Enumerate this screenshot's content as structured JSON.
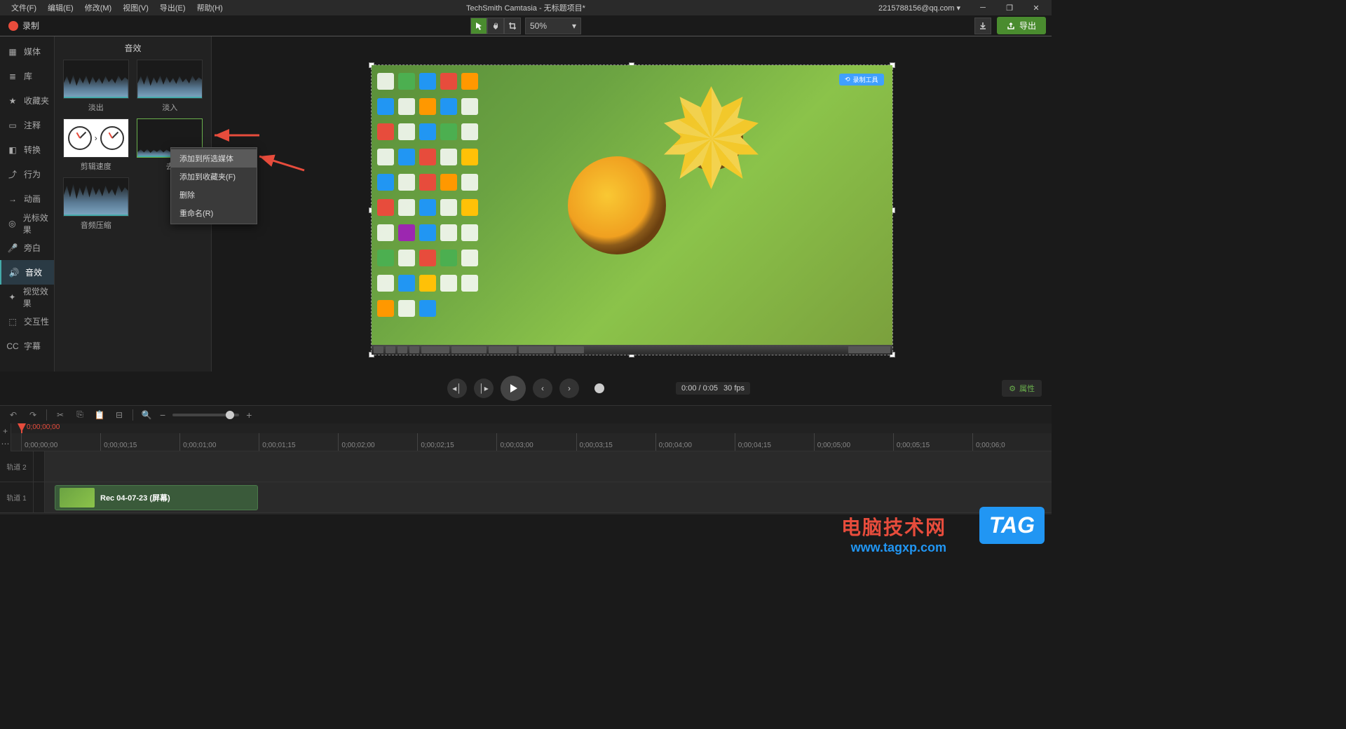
{
  "menubar": {
    "items": [
      "文件(F)",
      "编辑(E)",
      "修改(M)",
      "视图(V)",
      "导出(E)",
      "帮助(H)"
    ],
    "title": "TechSmith Camtasia - 无标题项目*",
    "user": "2215788156@qq.com ▾"
  },
  "toolbar": {
    "record": "录制",
    "zoom": "50%",
    "export": "导出"
  },
  "sidebar": {
    "items": [
      {
        "icon": "media",
        "label": "媒体"
      },
      {
        "icon": "library",
        "label": "库"
      },
      {
        "icon": "star",
        "label": "收藏夹"
      },
      {
        "icon": "annot",
        "label": "注释"
      },
      {
        "icon": "trans",
        "label": "转换"
      },
      {
        "icon": "behav",
        "label": "行为"
      },
      {
        "icon": "anim",
        "label": "动画"
      },
      {
        "icon": "cursor",
        "label": "光标效果"
      },
      {
        "icon": "mic",
        "label": "旁白"
      },
      {
        "icon": "audio",
        "label": "音效"
      },
      {
        "icon": "visual",
        "label": "视觉效果"
      },
      {
        "icon": "interact",
        "label": "交互性"
      },
      {
        "icon": "cc",
        "label": "字幕"
      }
    ],
    "active_index": 9
  },
  "panel": {
    "title": "音效",
    "effects": [
      {
        "label": "淡出",
        "type": "wave"
      },
      {
        "label": "淡入",
        "type": "wave"
      },
      {
        "label": "剪辑速度",
        "type": "clock"
      },
      {
        "label": "去",
        "type": "wave",
        "selected": true
      },
      {
        "label": "音频压缩",
        "type": "wave"
      }
    ]
  },
  "context_menu": {
    "items": [
      "添加到所选媒体",
      "添加到收藏夹(F)",
      "删除",
      "重命名(R)"
    ],
    "highlight_index": 0
  },
  "canvas": {
    "capture_badge": "录制工具"
  },
  "playback": {
    "time": "0:00 / 0:05",
    "fps": "30 fps",
    "props": "属性"
  },
  "timeline": {
    "playhead_time": "0;00;00;00",
    "ticks": [
      "0;00;00;00",
      "0;00;00;15",
      "0;00;01;00",
      "0;00;01;15",
      "0;00;02;00",
      "0;00;02;15",
      "0;00;03;00",
      "0;00;03;15",
      "0;00;04;00",
      "0;00;04;15",
      "0;00;05;00",
      "0;00;05;15",
      "0;00;06;0"
    ],
    "tracks": [
      {
        "label": "轨道 2"
      },
      {
        "label": "轨道 1"
      }
    ],
    "clip_label": "Rec 04-07-23 (屏幕)"
  },
  "watermark": {
    "cn": "电脑技术网",
    "url": "www.tagxp.com",
    "tag": "TAG"
  }
}
